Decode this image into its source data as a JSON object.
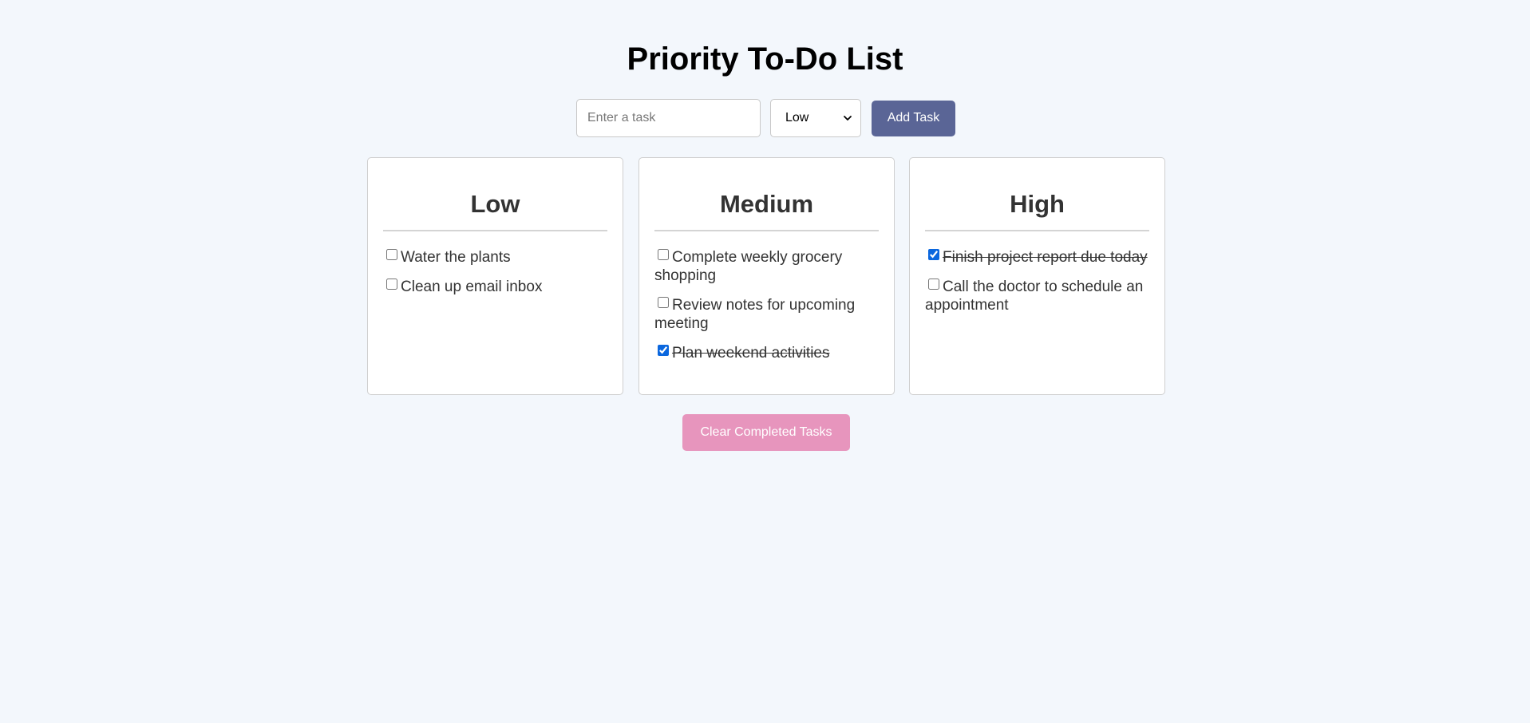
{
  "header": {
    "title": "Priority To-Do List"
  },
  "add_form": {
    "input_placeholder": "Enter a task",
    "input_value": "",
    "priority_selected": "Low",
    "add_button_label": "Add Task"
  },
  "columns": [
    {
      "title": "Low",
      "tasks": [
        {
          "text": "Water the plants",
          "done": false
        },
        {
          "text": "Clean up email inbox",
          "done": false
        }
      ]
    },
    {
      "title": "Medium",
      "tasks": [
        {
          "text": "Complete weekly grocery shopping",
          "done": false
        },
        {
          "text": "Review notes for upcoming meeting",
          "done": false
        },
        {
          "text": "Plan weekend activities",
          "done": true
        }
      ]
    },
    {
      "title": "High",
      "tasks": [
        {
          "text": "Finish project report due today",
          "done": true
        },
        {
          "text": "Call the doctor to schedule an appointment",
          "done": false
        }
      ]
    }
  ],
  "footer": {
    "clear_button_label": "Clear Completed Tasks"
  },
  "colors": {
    "background": "#f3f7fc",
    "add_button": "#5a6596",
    "clear_button": "#e795bd",
    "checkbox_accent": "#0b67de"
  },
  "icons": {
    "select_arrow": "chevron-down-icon"
  }
}
